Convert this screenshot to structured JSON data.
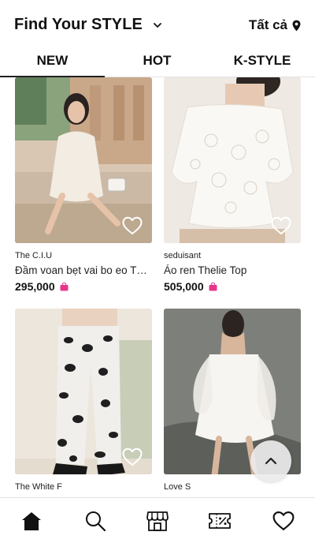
{
  "header": {
    "title": "Find Your STYLE",
    "location_label": "Tất cả"
  },
  "tabs": [
    {
      "label": "NEW",
      "active": true
    },
    {
      "label": "HOT",
      "active": false
    },
    {
      "label": "K-STYLE",
      "active": false
    }
  ],
  "products": [
    {
      "shop": "The C.I.U",
      "name": "Đầm voan bẹt vai bo eo THE C.I.U",
      "price": "295,000"
    },
    {
      "shop": "seduisant",
      "name": "Áo ren Thelie Top",
      "price": "505,000"
    },
    {
      "shop": "The White F",
      "name": "",
      "price": ""
    },
    {
      "shop": "Love S",
      "name": "",
      "price": ""
    }
  ],
  "icons": {
    "dropdown": "chevron-down-icon",
    "location": "location-pin-icon",
    "like": "heart-outline-icon",
    "shop_badge": "shopping-bag-icon",
    "scroll_top": "chevron-up-icon",
    "nav": [
      "home-icon",
      "search-icon",
      "store-icon",
      "coupon-icon",
      "heart-icon"
    ]
  },
  "colors": {
    "accent": "#e8358a",
    "text": "#111111",
    "divider": "#e3e3e3"
  }
}
